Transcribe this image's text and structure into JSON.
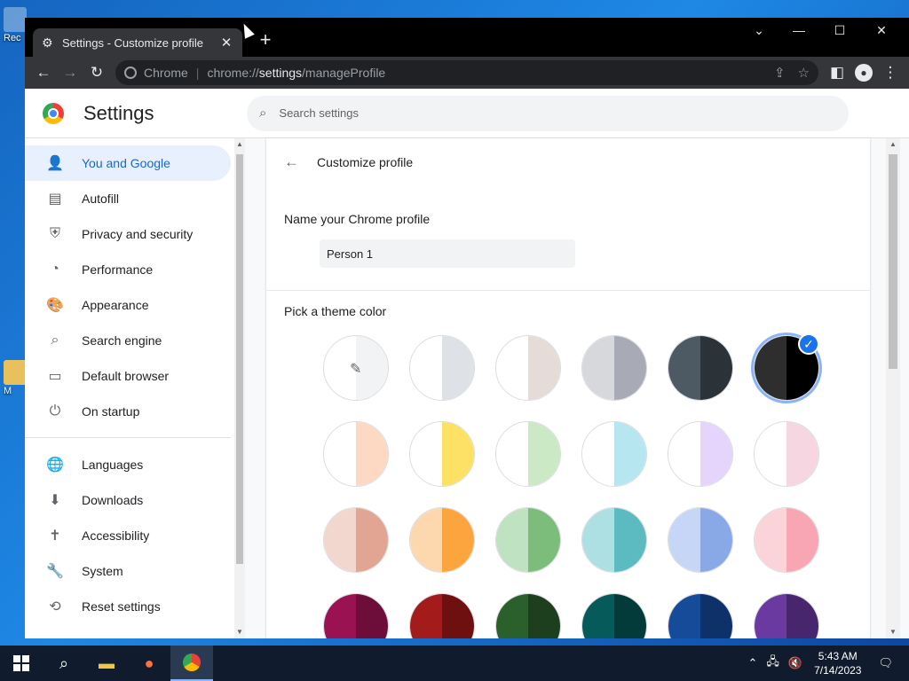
{
  "desktop": {
    "icons": [
      {
        "label": "Rec",
        "name": "recycle-bin"
      },
      {
        "label": "M",
        "name": "desktop-shortcut"
      }
    ]
  },
  "browser": {
    "tab": {
      "title": "Settings - Customize profile",
      "icon": "gear-icon"
    },
    "omnibox": {
      "scheme_label": "Chrome",
      "url_prefix": "chrome://",
      "url_host": "settings",
      "url_path": "/manageProfile"
    }
  },
  "settings": {
    "title": "Settings",
    "search_placeholder": "Search settings",
    "nav_primary": [
      {
        "label": "You and Google",
        "icon": "person-icon",
        "active": true
      },
      {
        "label": "Autofill",
        "icon": "clipboard-icon"
      },
      {
        "label": "Privacy and security",
        "icon": "shield-icon"
      },
      {
        "label": "Performance",
        "icon": "speedometer-icon"
      },
      {
        "label": "Appearance",
        "icon": "palette-icon"
      },
      {
        "label": "Search engine",
        "icon": "search-icon"
      },
      {
        "label": "Default browser",
        "icon": "browser-icon"
      },
      {
        "label": "On startup",
        "icon": "power-icon"
      }
    ],
    "nav_secondary": [
      {
        "label": "Languages",
        "icon": "globe-icon"
      },
      {
        "label": "Downloads",
        "icon": "download-icon"
      },
      {
        "label": "Accessibility",
        "icon": "accessibility-icon"
      },
      {
        "label": "System",
        "icon": "wrench-icon"
      },
      {
        "label": "Reset settings",
        "icon": "history-icon"
      }
    ]
  },
  "customize": {
    "heading": "Customize profile",
    "name_label": "Name your Chrome profile",
    "name_value": "Person 1",
    "theme_label": "Pick a theme color",
    "selected_index": 5,
    "swatches": [
      {
        "left": "#ffffff",
        "right": "#f1f3f4",
        "type": "picker"
      },
      {
        "left": "#ffffff",
        "right": "#dee1e6"
      },
      {
        "left": "#ffffff",
        "right": "#e5dcd7"
      },
      {
        "left": "#d7d8dc",
        "right": "#a8abb5"
      },
      {
        "left": "#4d5963",
        "right": "#2b3338"
      },
      {
        "left": "#2e2e2e",
        "right": "#000000"
      },
      {
        "left": "#ffffff",
        "right": "#fdd9c4"
      },
      {
        "left": "#ffffff",
        "right": "#fde164"
      },
      {
        "left": "#ffffff",
        "right": "#cce9c5"
      },
      {
        "left": "#ffffff",
        "right": "#b6e7f1"
      },
      {
        "left": "#ffffff",
        "right": "#e5d4fb"
      },
      {
        "left": "#ffffff",
        "right": "#f6d6e1"
      },
      {
        "left": "#f2d7cf",
        "right": "#e1a593"
      },
      {
        "left": "#fdd7ad",
        "right": "#fca53f"
      },
      {
        "left": "#bfe2c0",
        "right": "#7dbd7b"
      },
      {
        "left": "#ade0e2",
        "right": "#5bbbc0"
      },
      {
        "left": "#c5d6f6",
        "right": "#88a9e6"
      },
      {
        "left": "#fbd4da",
        "right": "#f8a6b3"
      },
      {
        "left": "#9a1251",
        "right": "#6d0e3a"
      },
      {
        "left": "#a31b1b",
        "right": "#6e1010"
      },
      {
        "left": "#2b5f2b",
        "right": "#1d3f1d"
      },
      {
        "left": "#075a5a",
        "right": "#033b3b"
      },
      {
        "left": "#164b9a",
        "right": "#0e316a"
      },
      {
        "left": "#6a3aa0",
        "right": "#47266d"
      }
    ]
  },
  "taskbar": {
    "apps": [
      {
        "name": "search",
        "icon": "search-icon"
      },
      {
        "name": "file-explorer",
        "icon": "folder-icon"
      },
      {
        "name": "firefox",
        "icon": "firefox-icon"
      },
      {
        "name": "chrome",
        "icon": "chrome-icon",
        "active": true
      }
    ],
    "time": "5:43 AM",
    "date": "7/14/2023"
  }
}
